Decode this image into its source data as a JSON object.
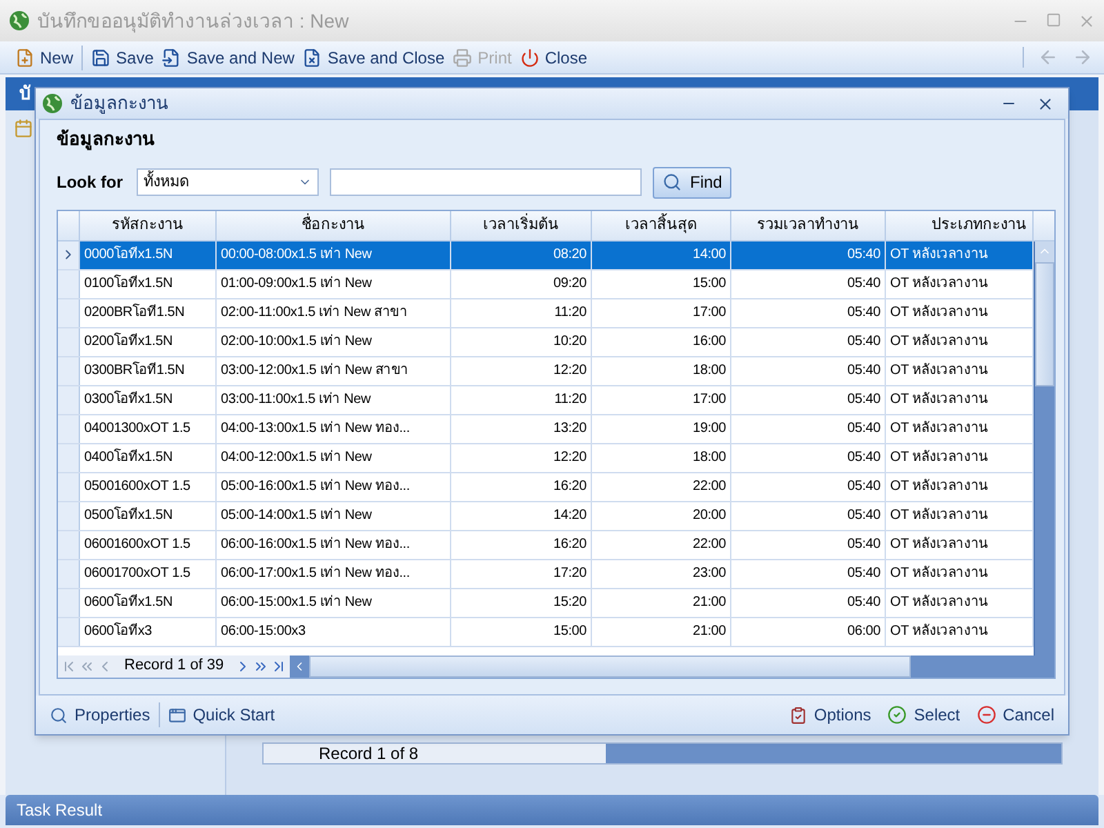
{
  "window": {
    "title": "บันทึกขออนุมัติทำงานล่วงเวลา : New"
  },
  "toolbar": [
    {
      "label": "New",
      "disabled": false
    },
    {
      "label": "Save",
      "disabled": false
    },
    {
      "label": "Save and New",
      "disabled": false
    },
    {
      "label": "Save and Close",
      "disabled": false
    },
    {
      "label": "Print",
      "disabled": true
    },
    {
      "label": "Close",
      "disabled": false
    }
  ],
  "background": {
    "band_text": "บั",
    "navigator": "Record 1 of 8"
  },
  "dialog": {
    "title": "ข้อมูลกะงาน",
    "heading": "ข้อมูลกะงาน",
    "look_for_label": "Look for",
    "look_for_value": "ทั้งหมด",
    "find_button": "Find",
    "columns": [
      "รหัสกะงาน",
      "ชื่อกะงาน",
      "เวลาเริ่มต้น",
      "เวลาสิ้นสุด",
      "รวมเวลาทำงาน",
      "ประเภทกะงาน"
    ],
    "rows": [
      {
        "selected": true,
        "cells": [
          "0000โอทีx1.5N",
          "00:00-08:00x1.5 เท่า New",
          "08:20",
          "14:00",
          "05:40",
          "OT หลังเวลางาน"
        ]
      },
      {
        "selected": false,
        "cells": [
          "0100โอทีx1.5N",
          "01:00-09:00x1.5 เท่า New",
          "09:20",
          "15:00",
          "05:40",
          "OT หลังเวลางาน"
        ]
      },
      {
        "selected": false,
        "cells": [
          "0200BRโอที1.5N",
          "02:00-11:00x1.5 เท่า New สาขา",
          "11:20",
          "17:00",
          "05:40",
          "OT หลังเวลางาน"
        ]
      },
      {
        "selected": false,
        "cells": [
          "0200โอทีx1.5N",
          "02:00-10:00x1.5 เท่า New",
          "10:20",
          "16:00",
          "05:40",
          "OT หลังเวลางาน"
        ]
      },
      {
        "selected": false,
        "cells": [
          "0300BRโอที1.5N",
          "03:00-12:00x1.5 เท่า New สาขา",
          "12:20",
          "18:00",
          "05:40",
          "OT หลังเวลางาน"
        ]
      },
      {
        "selected": false,
        "cells": [
          "0300โอทีx1.5N",
          "03:00-11:00x1.5 เท่า New",
          "11:20",
          "17:00",
          "05:40",
          "OT หลังเวลางาน"
        ]
      },
      {
        "selected": false,
        "cells": [
          "04001300xOT 1.5",
          "04:00-13:00x1.5 เท่า New ทอง...",
          "13:20",
          "19:00",
          "05:40",
          "OT หลังเวลางาน"
        ]
      },
      {
        "selected": false,
        "cells": [
          "0400โอทีx1.5N",
          "04:00-12:00x1.5 เท่า New",
          "12:20",
          "18:00",
          "05:40",
          "OT หลังเวลางาน"
        ]
      },
      {
        "selected": false,
        "cells": [
          "05001600xOT 1.5",
          "05:00-16:00x1.5 เท่า New ทอง...",
          "16:20",
          "22:00",
          "05:40",
          "OT หลังเวลางาน"
        ]
      },
      {
        "selected": false,
        "cells": [
          "0500โอทีx1.5N",
          "05:00-14:00x1.5 เท่า New",
          "14:20",
          "20:00",
          "05:40",
          "OT หลังเวลางาน"
        ]
      },
      {
        "selected": false,
        "cells": [
          "06001600xOT 1.5",
          "06:00-16:00x1.5 เท่า New ทอง...",
          "16:20",
          "22:00",
          "05:40",
          "OT หลังเวลางาน"
        ]
      },
      {
        "selected": false,
        "cells": [
          "06001700xOT 1.5",
          "06:00-17:00x1.5 เท่า New ทอง...",
          "17:20",
          "23:00",
          "05:40",
          "OT หลังเวลางาน"
        ]
      },
      {
        "selected": false,
        "cells": [
          "0600โอทีx1.5N",
          "06:00-15:00x1.5 เท่า New",
          "15:20",
          "21:00",
          "05:40",
          "OT หลังเวลางาน"
        ]
      },
      {
        "selected": false,
        "cells": [
          "0600โอทีx3",
          "06:00-15:00x3",
          "15:00",
          "21:00",
          "06:00",
          "OT หลังเวลางาน"
        ]
      }
    ],
    "navigator": "Record 1 of 39",
    "footer_left": [
      "Properties",
      "Quick Start"
    ],
    "footer_right": [
      "Options",
      "Select",
      "Cancel"
    ]
  },
  "task_panel": {
    "title": "Task Result"
  }
}
